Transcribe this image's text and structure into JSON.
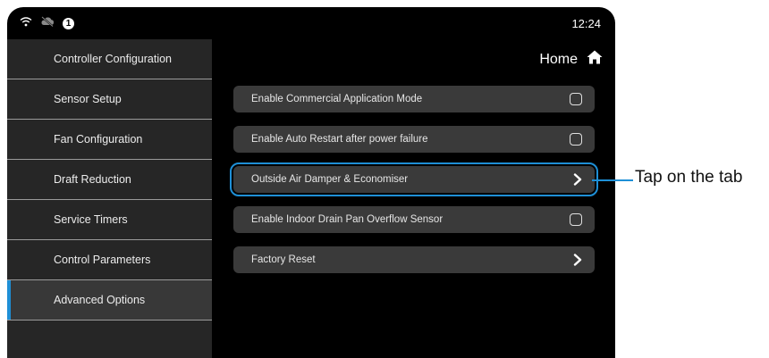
{
  "status": {
    "time": "12:24",
    "notification_count": "1"
  },
  "sidebar": {
    "items": [
      {
        "label": "Controller Configuration"
      },
      {
        "label": "Sensor Setup"
      },
      {
        "label": "Fan Configuration"
      },
      {
        "label": "Draft Reduction"
      },
      {
        "label": "Service Timers"
      },
      {
        "label": "Control Parameters"
      },
      {
        "label": "Advanced Options",
        "active": true
      }
    ]
  },
  "header": {
    "home_label": "Home"
  },
  "settings": [
    {
      "label": "Enable Commercial Application Mode",
      "control": "checkbox",
      "checked": false
    },
    {
      "label": "Enable Auto Restart after power failure",
      "control": "checkbox",
      "checked": false
    },
    {
      "label": "Outside Air Damper & Economiser",
      "control": "chevron",
      "highlighted": true
    },
    {
      "label": "Enable Indoor Drain Pan Overflow Sensor",
      "control": "checkbox",
      "checked": false
    },
    {
      "label": "Factory Reset",
      "control": "chevron"
    }
  ],
  "annotation": {
    "text": "Tap on the tab"
  },
  "colors": {
    "accent": "#1e8fd6",
    "sidebar_bg": "#262626",
    "row_bg": "#3a3a3a"
  }
}
